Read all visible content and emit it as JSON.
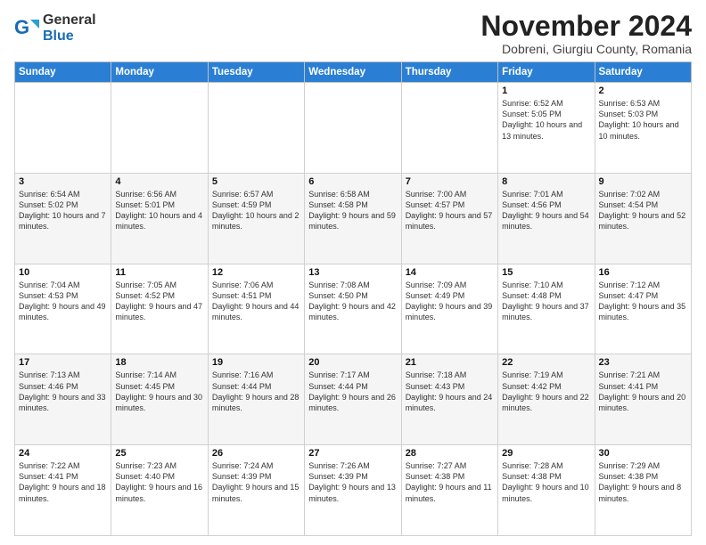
{
  "logo": {
    "general": "General",
    "blue": "Blue"
  },
  "header": {
    "month": "November 2024",
    "location": "Dobreni, Giurgiu County, Romania"
  },
  "weekdays": [
    "Sunday",
    "Monday",
    "Tuesday",
    "Wednesday",
    "Thursday",
    "Friday",
    "Saturday"
  ],
  "weeks": [
    [
      {
        "day": "",
        "info": ""
      },
      {
        "day": "",
        "info": ""
      },
      {
        "day": "",
        "info": ""
      },
      {
        "day": "",
        "info": ""
      },
      {
        "day": "",
        "info": ""
      },
      {
        "day": "1",
        "info": "Sunrise: 6:52 AM\nSunset: 5:05 PM\nDaylight: 10 hours\nand 13 minutes."
      },
      {
        "day": "2",
        "info": "Sunrise: 6:53 AM\nSunset: 5:03 PM\nDaylight: 10 hours\nand 10 minutes."
      }
    ],
    [
      {
        "day": "3",
        "info": "Sunrise: 6:54 AM\nSunset: 5:02 PM\nDaylight: 10 hours\nand 7 minutes."
      },
      {
        "day": "4",
        "info": "Sunrise: 6:56 AM\nSunset: 5:01 PM\nDaylight: 10 hours\nand 4 minutes."
      },
      {
        "day": "5",
        "info": "Sunrise: 6:57 AM\nSunset: 4:59 PM\nDaylight: 10 hours\nand 2 minutes."
      },
      {
        "day": "6",
        "info": "Sunrise: 6:58 AM\nSunset: 4:58 PM\nDaylight: 9 hours\nand 59 minutes."
      },
      {
        "day": "7",
        "info": "Sunrise: 7:00 AM\nSunset: 4:57 PM\nDaylight: 9 hours\nand 57 minutes."
      },
      {
        "day": "8",
        "info": "Sunrise: 7:01 AM\nSunset: 4:56 PM\nDaylight: 9 hours\nand 54 minutes."
      },
      {
        "day": "9",
        "info": "Sunrise: 7:02 AM\nSunset: 4:54 PM\nDaylight: 9 hours\nand 52 minutes."
      }
    ],
    [
      {
        "day": "10",
        "info": "Sunrise: 7:04 AM\nSunset: 4:53 PM\nDaylight: 9 hours\nand 49 minutes."
      },
      {
        "day": "11",
        "info": "Sunrise: 7:05 AM\nSunset: 4:52 PM\nDaylight: 9 hours\nand 47 minutes."
      },
      {
        "day": "12",
        "info": "Sunrise: 7:06 AM\nSunset: 4:51 PM\nDaylight: 9 hours\nand 44 minutes."
      },
      {
        "day": "13",
        "info": "Sunrise: 7:08 AM\nSunset: 4:50 PM\nDaylight: 9 hours\nand 42 minutes."
      },
      {
        "day": "14",
        "info": "Sunrise: 7:09 AM\nSunset: 4:49 PM\nDaylight: 9 hours\nand 39 minutes."
      },
      {
        "day": "15",
        "info": "Sunrise: 7:10 AM\nSunset: 4:48 PM\nDaylight: 9 hours\nand 37 minutes."
      },
      {
        "day": "16",
        "info": "Sunrise: 7:12 AM\nSunset: 4:47 PM\nDaylight: 9 hours\nand 35 minutes."
      }
    ],
    [
      {
        "day": "17",
        "info": "Sunrise: 7:13 AM\nSunset: 4:46 PM\nDaylight: 9 hours\nand 33 minutes."
      },
      {
        "day": "18",
        "info": "Sunrise: 7:14 AM\nSunset: 4:45 PM\nDaylight: 9 hours\nand 30 minutes."
      },
      {
        "day": "19",
        "info": "Sunrise: 7:16 AM\nSunset: 4:44 PM\nDaylight: 9 hours\nand 28 minutes."
      },
      {
        "day": "20",
        "info": "Sunrise: 7:17 AM\nSunset: 4:44 PM\nDaylight: 9 hours\nand 26 minutes."
      },
      {
        "day": "21",
        "info": "Sunrise: 7:18 AM\nSunset: 4:43 PM\nDaylight: 9 hours\nand 24 minutes."
      },
      {
        "day": "22",
        "info": "Sunrise: 7:19 AM\nSunset: 4:42 PM\nDaylight: 9 hours\nand 22 minutes."
      },
      {
        "day": "23",
        "info": "Sunrise: 7:21 AM\nSunset: 4:41 PM\nDaylight: 9 hours\nand 20 minutes."
      }
    ],
    [
      {
        "day": "24",
        "info": "Sunrise: 7:22 AM\nSunset: 4:41 PM\nDaylight: 9 hours\nand 18 minutes."
      },
      {
        "day": "25",
        "info": "Sunrise: 7:23 AM\nSunset: 4:40 PM\nDaylight: 9 hours\nand 16 minutes."
      },
      {
        "day": "26",
        "info": "Sunrise: 7:24 AM\nSunset: 4:39 PM\nDaylight: 9 hours\nand 15 minutes."
      },
      {
        "day": "27",
        "info": "Sunrise: 7:26 AM\nSunset: 4:39 PM\nDaylight: 9 hours\nand 13 minutes."
      },
      {
        "day": "28",
        "info": "Sunrise: 7:27 AM\nSunset: 4:38 PM\nDaylight: 9 hours\nand 11 minutes."
      },
      {
        "day": "29",
        "info": "Sunrise: 7:28 AM\nSunset: 4:38 PM\nDaylight: 9 hours\nand 10 minutes."
      },
      {
        "day": "30",
        "info": "Sunrise: 7:29 AM\nSunset: 4:38 PM\nDaylight: 9 hours\nand 8 minutes."
      }
    ]
  ]
}
